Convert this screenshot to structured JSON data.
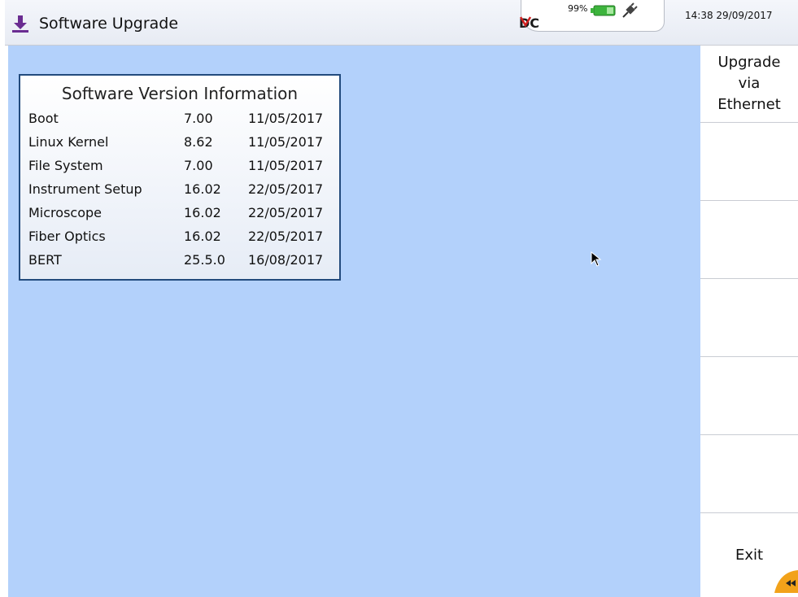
{
  "header": {
    "title": "Software Upgrade",
    "title_icon": "download-icon",
    "logo_text": "DC",
    "battery_percent": "99%",
    "datetime": "14:38 29/09/2017"
  },
  "version_panel": {
    "title": "Software Version Information",
    "rows": [
      {
        "name": "Boot",
        "version": "7.00",
        "date": "11/05/2017"
      },
      {
        "name": "Linux Kernel",
        "version": "8.62",
        "date": "11/05/2017"
      },
      {
        "name": "File System",
        "version": "7.00",
        "date": "11/05/2017"
      },
      {
        "name": "Instrument Setup",
        "version": "16.02",
        "date": "22/05/2017"
      },
      {
        "name": "Microscope",
        "version": "16.02",
        "date": "22/05/2017"
      },
      {
        "name": "Fiber Optics",
        "version": "16.02",
        "date": "22/05/2017"
      },
      {
        "name": "BERT",
        "version": "25.5.0",
        "date": "16/08/2017"
      }
    ]
  },
  "softkeys": {
    "upgrade_label": "Upgrade\nvia\nEthernet",
    "key2_label": "",
    "key3_label": "",
    "key4_label": "",
    "key5_label": "",
    "key6_label": "",
    "exit_label": "Exit"
  },
  "colors": {
    "background_blue": "#b3d1fb",
    "panel_border": "#234b7d",
    "accent_purple": "#6a2c91",
    "battery_green": "#3cb43c",
    "corner_orange": "#f2a21a"
  }
}
